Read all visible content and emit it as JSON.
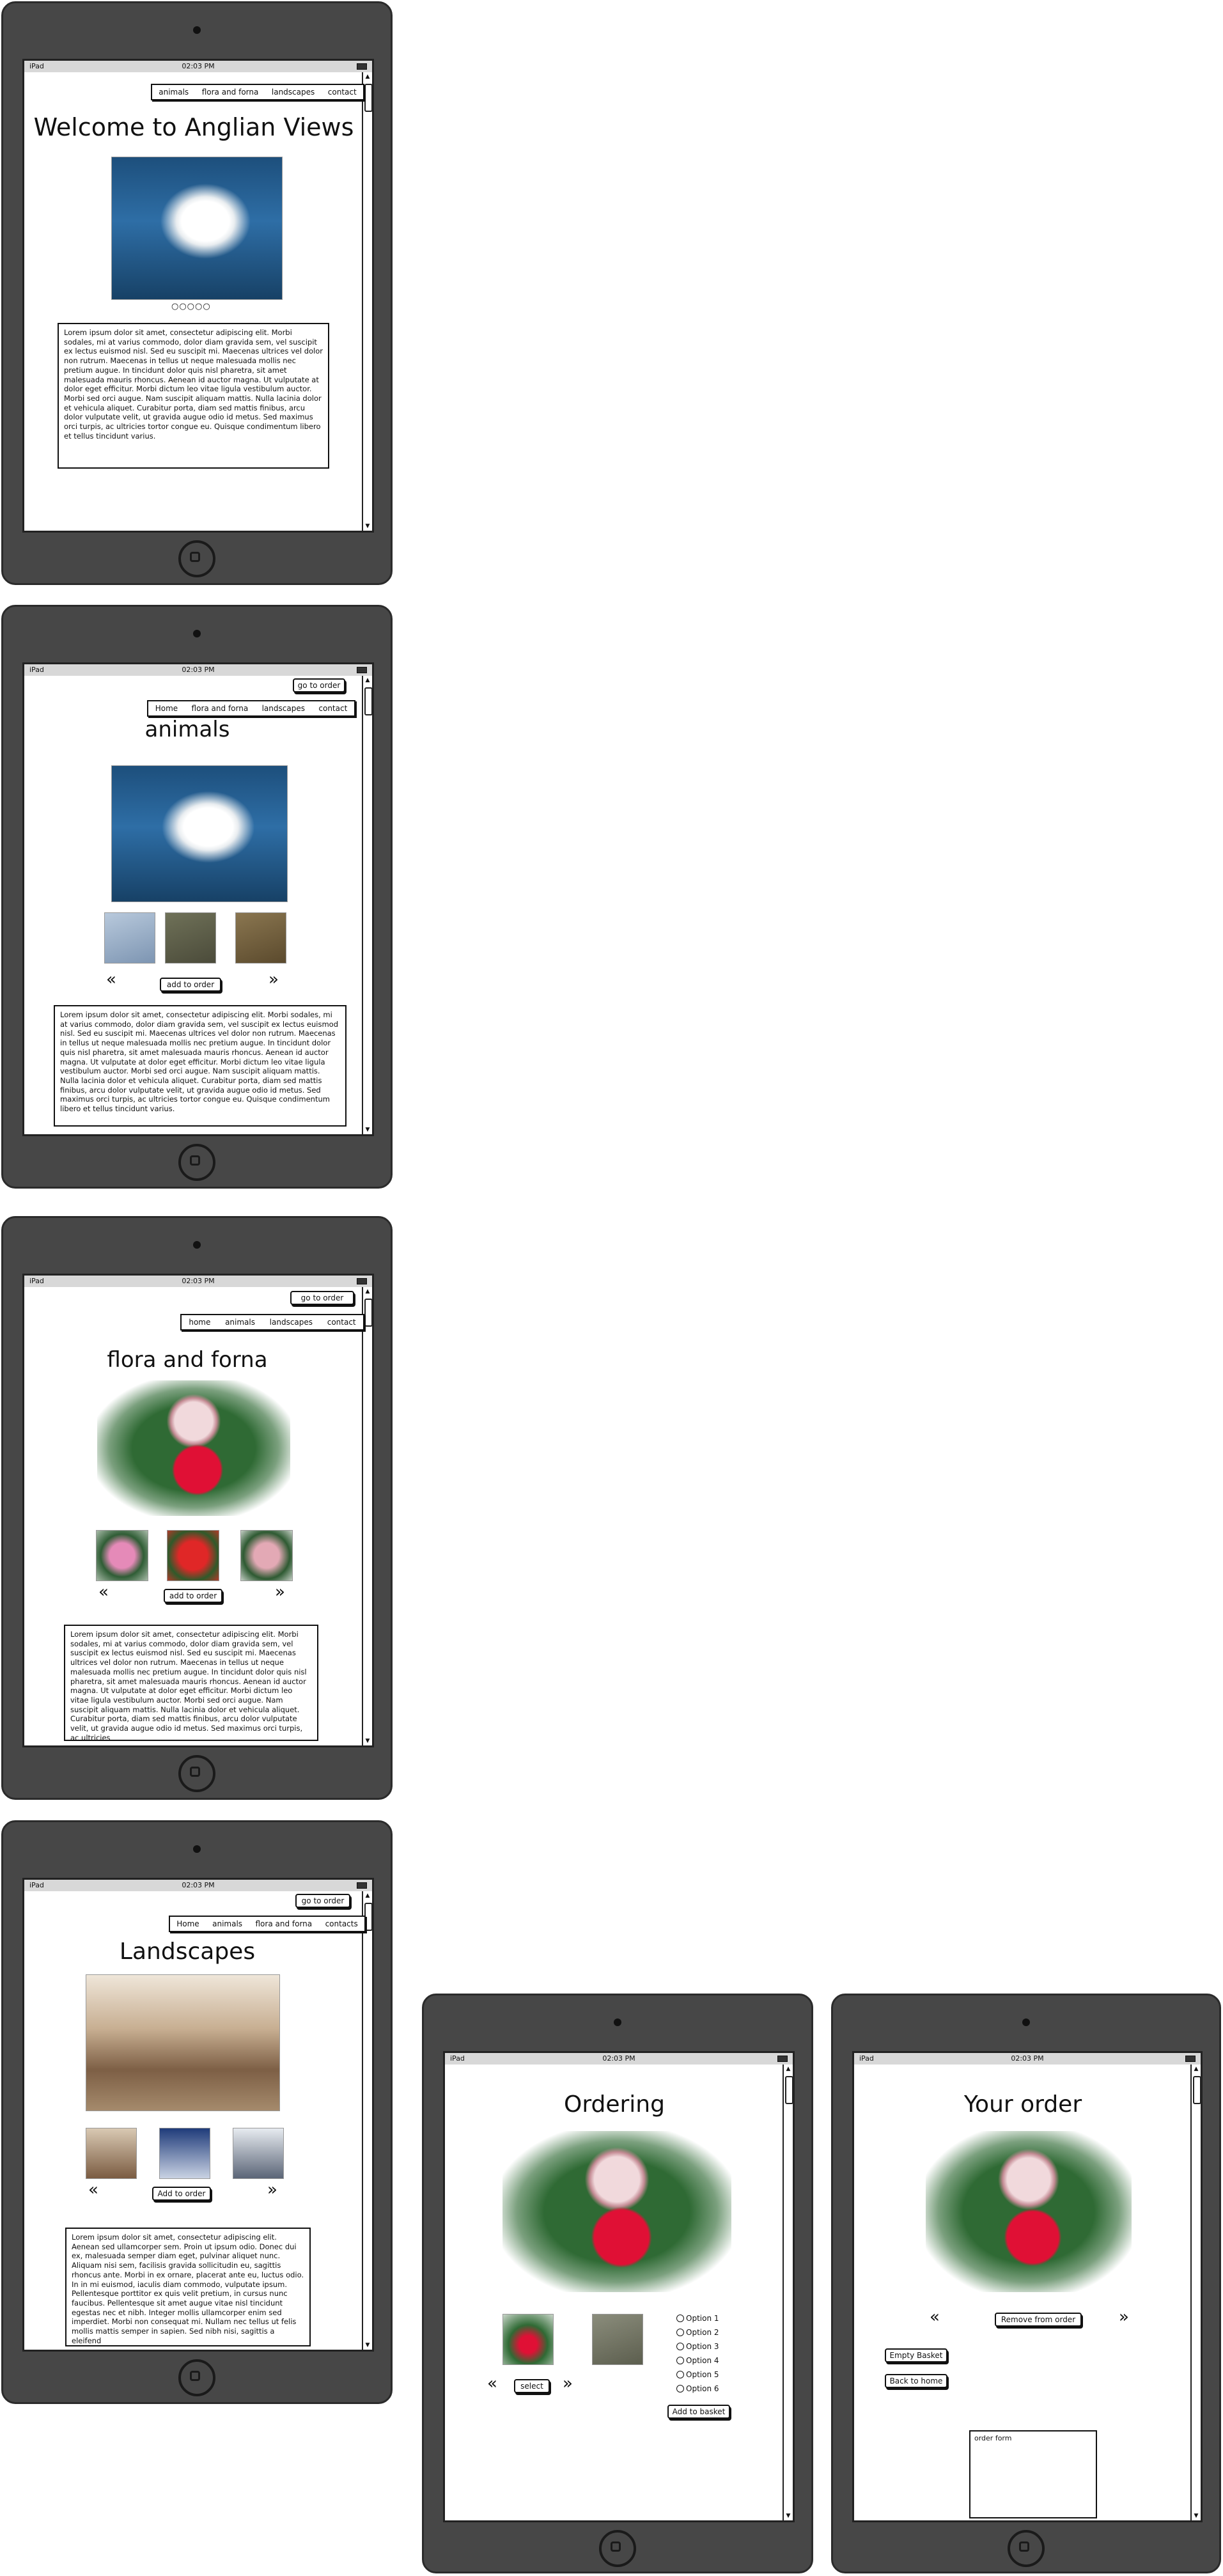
{
  "status": {
    "carrier": "iPad",
    "time": "02:03 PM"
  },
  "icons": {
    "wifi": "wifi-icon",
    "battery": "battery-icon",
    "home": "home-button-icon",
    "prev": "double-chevron-left-icon",
    "next": "double-chevron-right-icon"
  },
  "home": {
    "nav": [
      "animals",
      "flora and forna",
      "landscapes",
      "contact"
    ],
    "title": "Welcome to Anglian Views",
    "dots": "○○○○○",
    "text": "Lorem ipsum dolor sit amet, consectetur adipiscing elit. Morbi sodales, mi at varius commodo, dolor diam gravida sem, vel suscipit ex lectus euismod nisl. Sed eu suscipit mi. Maecenas ultrices vel dolor non rutrum. Maecenas in tellus ut neque malesuada mollis nec pretium augue. In tincidunt dolor quis nisl pharetra, sit amet malesuada mauris rhoncus. Aenean id auctor magna. Ut vulputate at dolor eget efficitur. Morbi dictum leo vitae ligula vestibulum auctor. Morbi sed orci augue. Nam suscipit aliquam mattis. Nulla lacinia dolor et vehicula aliquet. Curabitur porta, diam sed mattis finibus, arcu dolor vulputate velit, ut gravida augue odio id metus. Sed maximus orci turpis, ac ultricies tortor congue eu. Quisque condimentum libero et tellus tincidunt varius."
  },
  "animals": {
    "order_button": "go to order",
    "nav": [
      "Home",
      "flora and forna",
      "landscapes",
      "contact"
    ],
    "title": "animals",
    "add_button": "add to order",
    "text": "Lorem ipsum dolor sit amet, consectetur adipiscing elit. Morbi sodales, mi at varius commodo, dolor diam gravida sem, vel suscipit ex lectus euismod nisl. Sed eu suscipit mi. Maecenas ultrices vel dolor non rutrum. Maecenas in tellus ut neque malesuada mollis nec pretium augue. In tincidunt dolor quis nisl pharetra, sit amet malesuada mauris rhoncus. Aenean id auctor magna. Ut vulputate at dolor eget efficitur. Morbi dictum leo vitae ligula vestibulum auctor. Morbi sed orci augue. Nam suscipit aliquam mattis. Nulla lacinia dolor et vehicula aliquet. Curabitur porta, diam sed mattis finibus, arcu dolor vulputate velit, ut gravida augue odio id metus. Sed maximus orci turpis, ac ultricies tortor congue eu. Quisque condimentum libero et tellus tincidunt varius."
  },
  "flora": {
    "order_button": "go to order",
    "nav": [
      "home",
      "animals",
      "landscapes",
      "contact"
    ],
    "title": "flora and forna",
    "add_button": "add to order",
    "text": "Lorem ipsum dolor sit amet, consectetur adipiscing elit. Morbi sodales, mi at varius commodo, dolor diam gravida sem, vel suscipit ex lectus euismod nisl. Sed eu suscipit mi. Maecenas ultrices vel dolor non rutrum. Maecenas in tellus ut neque malesuada mollis nec pretium augue. In tincidunt dolor quis nisl pharetra, sit amet malesuada mauris rhoncus. Aenean id auctor magna. Ut vulputate at dolor eget efficitur. Morbi dictum leo vitae ligula vestibulum auctor. Morbi sed orci augue. Nam suscipit aliquam mattis. Nulla lacinia dolor et vehicula aliquet. Curabitur porta, diam sed mattis finibus, arcu dolor vulputate velit, ut gravida augue odio id metus. Sed maximus orci turpis, ac ultricies"
  },
  "landscapes": {
    "order_button": "go to order",
    "nav": [
      "Home",
      "animals",
      "flora and forna",
      "contacts"
    ],
    "title": "Landscapes",
    "add_button": "Add to order",
    "text": "Lorem ipsum dolor sit amet, consectetur adipiscing elit. Aenean sed ullamcorper sem. Proin ut ipsum odio. Donec dui ex, malesuada semper diam eget, pulvinar aliquet nunc. Aliquam nisi sem, facilisis gravida sollicitudin eu, sagittis rhoncus ante. Morbi in ex ornare, placerat ante eu, luctus odio. In in mi euismod, iaculis diam commodo, vulputate ipsum. Pellentesque porttitor ex quis velit pretium, in cursus nunc faucibus. Pellentesque sit amet augue vitae nisl tincidunt egestas nec et nibh. Integer mollis ullamcorper enim sed imperdiet. Morbi non consequat mi. Nullam nec tellus ut felis mollis mattis semper in sapien. Sed nibh nisi, sagittis a eleifend"
  },
  "ordering": {
    "title": "Ordering",
    "select_button": "select",
    "options": [
      "Option 1",
      "Option 2",
      "Option 3",
      "Option 4",
      "Option 5",
      "Option 6"
    ],
    "basket_button": "Add to basket"
  },
  "your_order": {
    "title": "Your order",
    "remove_button": "Remove from order",
    "empty_button": "Empty Basket",
    "back_button": "Back to home",
    "form_label": "order form"
  }
}
